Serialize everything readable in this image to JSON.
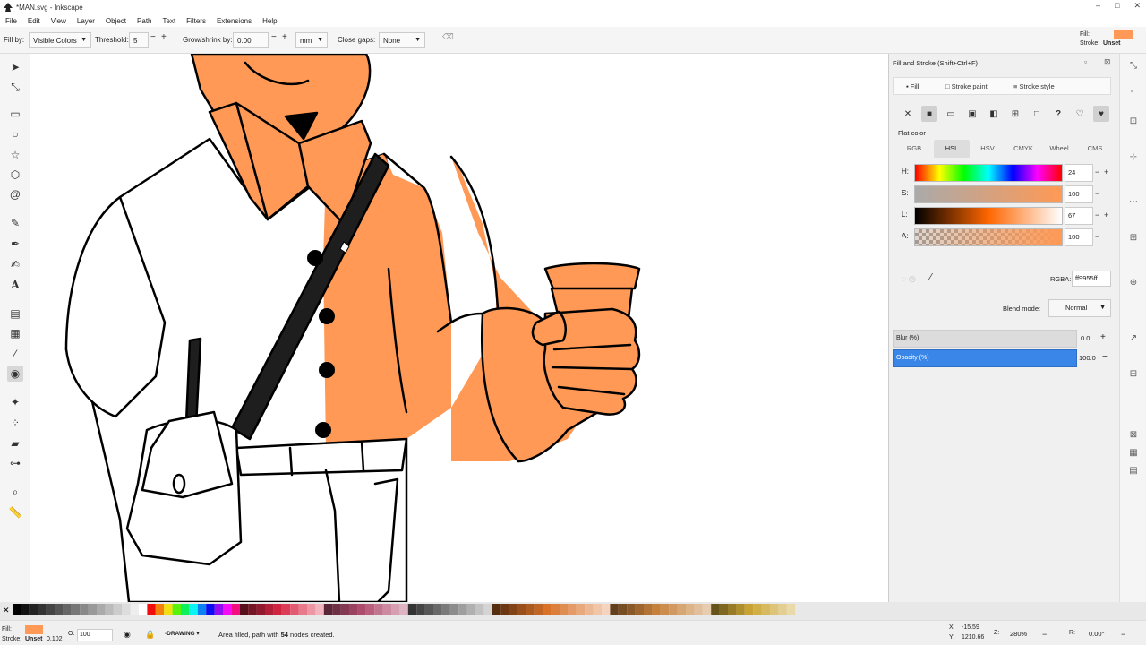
{
  "window": {
    "title": "*MAN.svg - Inkscape",
    "controls": [
      "–",
      "□",
      "✕"
    ]
  },
  "menu": [
    "File",
    "Edit",
    "View",
    "Layer",
    "Object",
    "Path",
    "Text",
    "Filters",
    "Extensions",
    "Help"
  ],
  "toolbar": {
    "fill_by_label": "Fill by:",
    "fill_by_value": "Visible Colors",
    "threshold_label": "Threshold:",
    "threshold_value": "5",
    "grow_label": "Grow/shrink by:",
    "grow_value": "0.00",
    "unit_value": "mm",
    "close_gaps_label": "Close gaps:",
    "close_gaps_value": "None"
  },
  "style_indicator": {
    "fill_label": "Fill:",
    "stroke_label": "Stroke:",
    "stroke_value": "Unset",
    "fill_color": "#ff9955"
  },
  "tools": [
    "selector-icon",
    "node-icon",
    "rect-icon",
    "circle-icon",
    "star-icon",
    "box3d-icon",
    "spiral-icon",
    "pencil-icon",
    "pen-icon",
    "calligraphy-icon",
    "text-icon",
    "gradient-icon",
    "mesh-icon",
    "dropper-icon",
    "paint-bucket-icon",
    "tweak-icon",
    "spray-icon",
    "eraser-icon",
    "connector-icon",
    "zoom-icon",
    "measure-icon"
  ],
  "dialog": {
    "title": "Fill and Stroke (Shift+Ctrl+F)",
    "tabs": [
      "Fill",
      "Stroke paint",
      "Stroke style"
    ],
    "flat_color_label": "Flat color",
    "color_modes": [
      "RGB",
      "HSL",
      "HSV",
      "CMYK",
      "Wheel",
      "CMS"
    ],
    "selected_mode": "HSL",
    "sliders": [
      {
        "label": "H:",
        "value": "24"
      },
      {
        "label": "S:",
        "value": "100"
      },
      {
        "label": "L:",
        "value": "67"
      },
      {
        "label": "A:",
        "value": "100"
      }
    ],
    "rgba_label": "RGBA:",
    "rgba_value": "ff9955ff",
    "blend_label": "Blend mode:",
    "blend_value": "Normal",
    "blur_label": "Blur (%)",
    "blur_value": "0.0",
    "opacity_label": "Opacity (%)",
    "opacity_value": "100.0"
  },
  "status": {
    "fill_label": "Fill:",
    "stroke_label": "Stroke:",
    "stroke_value": "Unset",
    "stroke_width": "0.102",
    "opacity_label": "O:",
    "opacity_value": "100",
    "mode": "-DRAWING",
    "message_pre": "Area filled, path with ",
    "message_count": "54",
    "message_post": " nodes created.",
    "x_label": "X:",
    "x_value": "-15.59",
    "y_label": "Y:",
    "y_value": "1210.66",
    "zoom_label": "Z:",
    "zoom_value": "280%",
    "rot_label": "R:",
    "rot_value": "0.00°"
  },
  "colors": {
    "skin": "#ff9955",
    "outline": "#000000",
    "strap": "#1e1e1e",
    "opacity_bar": "#3a86e8"
  }
}
